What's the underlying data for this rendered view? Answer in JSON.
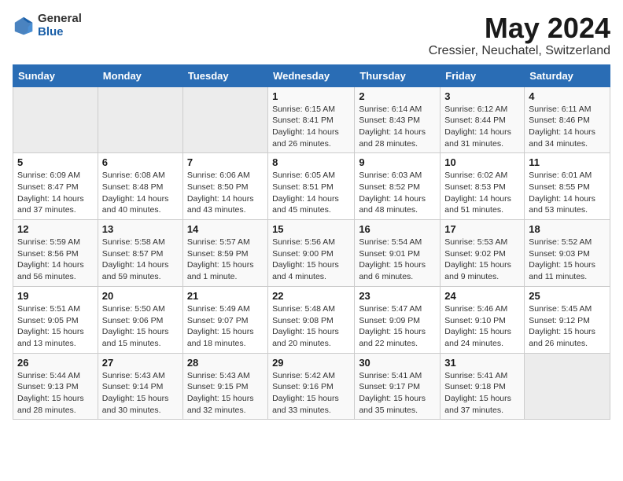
{
  "header": {
    "logo_general": "General",
    "logo_blue": "Blue",
    "title": "May 2024",
    "subtitle": "Cressier, Neuchatel, Switzerland"
  },
  "weekdays": [
    "Sunday",
    "Monday",
    "Tuesday",
    "Wednesday",
    "Thursday",
    "Friday",
    "Saturday"
  ],
  "weeks": [
    [
      {
        "day": "",
        "info": ""
      },
      {
        "day": "",
        "info": ""
      },
      {
        "day": "",
        "info": ""
      },
      {
        "day": "1",
        "info": "Sunrise: 6:15 AM\nSunset: 8:41 PM\nDaylight: 14 hours and 26 minutes."
      },
      {
        "day": "2",
        "info": "Sunrise: 6:14 AM\nSunset: 8:43 PM\nDaylight: 14 hours and 28 minutes."
      },
      {
        "day": "3",
        "info": "Sunrise: 6:12 AM\nSunset: 8:44 PM\nDaylight: 14 hours and 31 minutes."
      },
      {
        "day": "4",
        "info": "Sunrise: 6:11 AM\nSunset: 8:46 PM\nDaylight: 14 hours and 34 minutes."
      }
    ],
    [
      {
        "day": "5",
        "info": "Sunrise: 6:09 AM\nSunset: 8:47 PM\nDaylight: 14 hours and 37 minutes."
      },
      {
        "day": "6",
        "info": "Sunrise: 6:08 AM\nSunset: 8:48 PM\nDaylight: 14 hours and 40 minutes."
      },
      {
        "day": "7",
        "info": "Sunrise: 6:06 AM\nSunset: 8:50 PM\nDaylight: 14 hours and 43 minutes."
      },
      {
        "day": "8",
        "info": "Sunrise: 6:05 AM\nSunset: 8:51 PM\nDaylight: 14 hours and 45 minutes."
      },
      {
        "day": "9",
        "info": "Sunrise: 6:03 AM\nSunset: 8:52 PM\nDaylight: 14 hours and 48 minutes."
      },
      {
        "day": "10",
        "info": "Sunrise: 6:02 AM\nSunset: 8:53 PM\nDaylight: 14 hours and 51 minutes."
      },
      {
        "day": "11",
        "info": "Sunrise: 6:01 AM\nSunset: 8:55 PM\nDaylight: 14 hours and 53 minutes."
      }
    ],
    [
      {
        "day": "12",
        "info": "Sunrise: 5:59 AM\nSunset: 8:56 PM\nDaylight: 14 hours and 56 minutes."
      },
      {
        "day": "13",
        "info": "Sunrise: 5:58 AM\nSunset: 8:57 PM\nDaylight: 14 hours and 59 minutes."
      },
      {
        "day": "14",
        "info": "Sunrise: 5:57 AM\nSunset: 8:59 PM\nDaylight: 15 hours and 1 minute."
      },
      {
        "day": "15",
        "info": "Sunrise: 5:56 AM\nSunset: 9:00 PM\nDaylight: 15 hours and 4 minutes."
      },
      {
        "day": "16",
        "info": "Sunrise: 5:54 AM\nSunset: 9:01 PM\nDaylight: 15 hours and 6 minutes."
      },
      {
        "day": "17",
        "info": "Sunrise: 5:53 AM\nSunset: 9:02 PM\nDaylight: 15 hours and 9 minutes."
      },
      {
        "day": "18",
        "info": "Sunrise: 5:52 AM\nSunset: 9:03 PM\nDaylight: 15 hours and 11 minutes."
      }
    ],
    [
      {
        "day": "19",
        "info": "Sunrise: 5:51 AM\nSunset: 9:05 PM\nDaylight: 15 hours and 13 minutes."
      },
      {
        "day": "20",
        "info": "Sunrise: 5:50 AM\nSunset: 9:06 PM\nDaylight: 15 hours and 15 minutes."
      },
      {
        "day": "21",
        "info": "Sunrise: 5:49 AM\nSunset: 9:07 PM\nDaylight: 15 hours and 18 minutes."
      },
      {
        "day": "22",
        "info": "Sunrise: 5:48 AM\nSunset: 9:08 PM\nDaylight: 15 hours and 20 minutes."
      },
      {
        "day": "23",
        "info": "Sunrise: 5:47 AM\nSunset: 9:09 PM\nDaylight: 15 hours and 22 minutes."
      },
      {
        "day": "24",
        "info": "Sunrise: 5:46 AM\nSunset: 9:10 PM\nDaylight: 15 hours and 24 minutes."
      },
      {
        "day": "25",
        "info": "Sunrise: 5:45 AM\nSunset: 9:12 PM\nDaylight: 15 hours and 26 minutes."
      }
    ],
    [
      {
        "day": "26",
        "info": "Sunrise: 5:44 AM\nSunset: 9:13 PM\nDaylight: 15 hours and 28 minutes."
      },
      {
        "day": "27",
        "info": "Sunrise: 5:43 AM\nSunset: 9:14 PM\nDaylight: 15 hours and 30 minutes."
      },
      {
        "day": "28",
        "info": "Sunrise: 5:43 AM\nSunset: 9:15 PM\nDaylight: 15 hours and 32 minutes."
      },
      {
        "day": "29",
        "info": "Sunrise: 5:42 AM\nSunset: 9:16 PM\nDaylight: 15 hours and 33 minutes."
      },
      {
        "day": "30",
        "info": "Sunrise: 5:41 AM\nSunset: 9:17 PM\nDaylight: 15 hours and 35 minutes."
      },
      {
        "day": "31",
        "info": "Sunrise: 5:41 AM\nSunset: 9:18 PM\nDaylight: 15 hours and 37 minutes."
      },
      {
        "day": "",
        "info": ""
      }
    ]
  ]
}
